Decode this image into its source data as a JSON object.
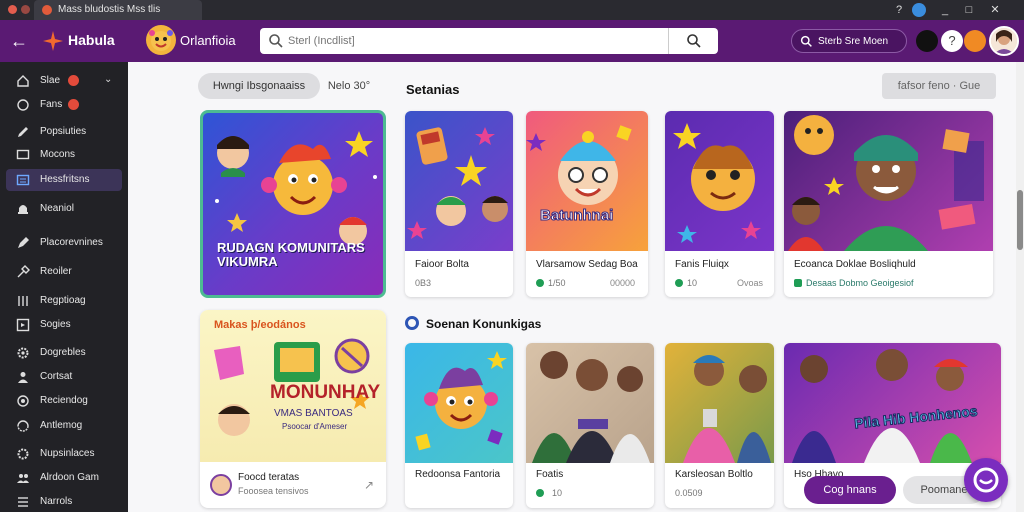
{
  "browser": {
    "tab_title": "Mass bludostis Mss tlis",
    "window_controls": [
      "?",
      "_",
      "□",
      "✕"
    ]
  },
  "header": {
    "app_name": "Habula",
    "brand": "Orlanfioia",
    "search_placeholder": "Sterl (Incdlist]",
    "pill_search_label": "Sterb Sre Moen"
  },
  "sidebar": {
    "items": [
      {
        "label": "Slae",
        "badge": true,
        "chevron": true,
        "icon": "home-icon"
      },
      {
        "label": "Fans",
        "badge": true,
        "icon": "refresh-icon"
      },
      {
        "label": "Popsiuties",
        "icon": "pencil-icon"
      },
      {
        "label": "Mocons",
        "icon": "monitor-icon"
      },
      {
        "label": "Hessfritsns",
        "active": true,
        "icon": "list-icon"
      },
      {
        "label": "Neaniol",
        "icon": "bell-icon"
      },
      {
        "label": "Placorevnines",
        "icon": "edit-icon"
      },
      {
        "label": "Reoiler",
        "icon": "tools-icon"
      },
      {
        "label": "Regptioag",
        "icon": "grid-icon"
      },
      {
        "label": "Sogies",
        "icon": "share-icon"
      },
      {
        "label": "Dogrebles",
        "icon": "gear-icon"
      },
      {
        "label": "Cortsat",
        "icon": "person-icon"
      },
      {
        "label": "Reciendog",
        "icon": "settings-icon"
      },
      {
        "label": "Antlemog",
        "icon": "sync-icon"
      },
      {
        "label": "Nupsinlaces",
        "icon": "gear-icon"
      },
      {
        "label": "Alrdoon Gam",
        "icon": "people-icon"
      },
      {
        "label": "Narrols",
        "icon": "lines-icon"
      }
    ]
  },
  "filters": {
    "pill_active": "Hwngi Ibsgonaaiss",
    "pill_plain": "Nelo 30°",
    "right_button": "fafsor feno · Gue"
  },
  "featured": {
    "title": "RUDAGN KOMUNITARS VIKUMRA"
  },
  "promo": {
    "title": "Makas þ/eodános",
    "big": "MONUNHAY",
    "sub": "VMAS BANTOAS",
    "sub2": "Psoocar d'Ameser",
    "user_name": "Foocd teratas",
    "user_meta": "Fooosea tensivos"
  },
  "section1": {
    "title": "Setanias",
    "cards": [
      {
        "title": "Faioor Bolta",
        "meta": "0B3",
        "meta2": ""
      },
      {
        "title": "Vlarsamow Sedag Boa",
        "meta": "1/50",
        "meta2": "00000",
        "dot": true
      },
      {
        "title": "Fanis Fluiqx",
        "meta": "10",
        "meta2": "Ovoas",
        "dot": true
      },
      {
        "title": "Ecoanca Doklae Bosliqhuld",
        "meta": "Desaas Dobmo Geoigesiof",
        "meta2": "",
        "dot": true
      }
    ]
  },
  "section2": {
    "title": "Soenan Konunkigas",
    "cards": [
      {
        "title": "Redoonsa Fantoria",
        "meta": "",
        "dot": false
      },
      {
        "title": "Foatis",
        "meta": "10",
        "dot": true
      },
      {
        "title": "Karsleosan Boltlo",
        "meta": "0.0509",
        "dot": false
      },
      {
        "title": "Hso Hhavo",
        "meta": "",
        "dot": false
      }
    ]
  },
  "card_art": {
    "card1_label": "Batunhnai",
    "card4_label": "Pila Hib Honhenos"
  },
  "actions": {
    "primary": "Cog hnans",
    "secondary": "Poomane"
  },
  "colors": {
    "header": "#5a1a73",
    "sidebar": "#222226",
    "accent": "#7b2cbf",
    "featured_border": "#4dbb92"
  }
}
